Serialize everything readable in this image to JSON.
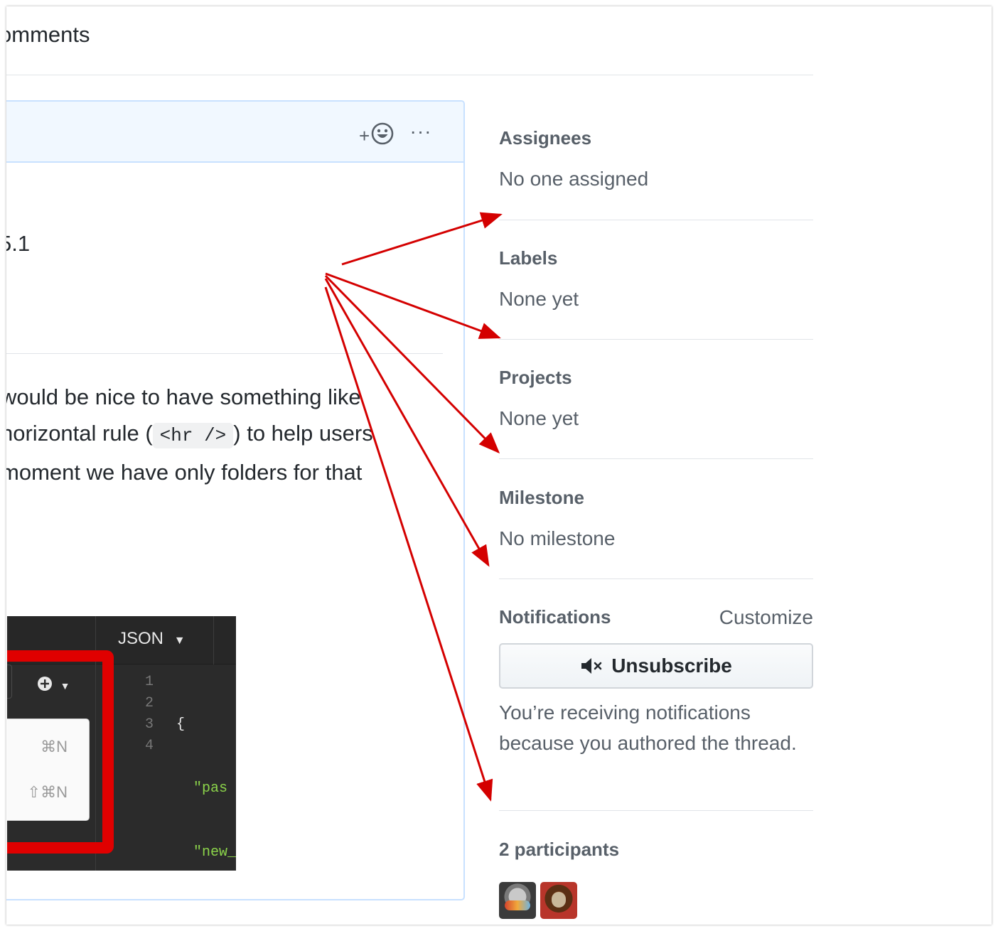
{
  "header": {
    "title": "omments"
  },
  "comment": {
    "reaction_plus": "+",
    "more": "···",
    "version_text": "5.1",
    "paragraph": {
      "line1": "would be nice to have something like",
      "line2_before": " horizontal rule (",
      "line2_code": "<hr />",
      "line2_after": ") to help users",
      "line3": " moment we have only folders for that"
    }
  },
  "screenshot": {
    "format_dropdown": "JSON",
    "shortcut_1": "⌘N",
    "shortcut_2": "⇧⌘N",
    "line_numbers": [
      "1",
      "2",
      "3",
      "4"
    ],
    "code_lines": [
      "{",
      "  \"pas",
      "  \"new_",
      "}"
    ]
  },
  "sidebar": {
    "assignees": {
      "heading": "Assignees",
      "value": "No one assigned"
    },
    "labels": {
      "heading": "Labels",
      "value": "None yet"
    },
    "projects": {
      "heading": "Projects",
      "value": "None yet"
    },
    "milestone": {
      "heading": "Milestone",
      "value": "No milestone"
    },
    "notifications": {
      "heading": "Notifications",
      "customize": "Customize",
      "unsubscribe": "Unsubscribe",
      "text": "You’re receiving notifications because you authored the thread."
    },
    "participants": {
      "heading": "2 participants"
    }
  },
  "colors": {
    "annotation_arrow": "#d40000",
    "sidebar_text": "#586069",
    "comment_border": "#c8e1ff"
  }
}
